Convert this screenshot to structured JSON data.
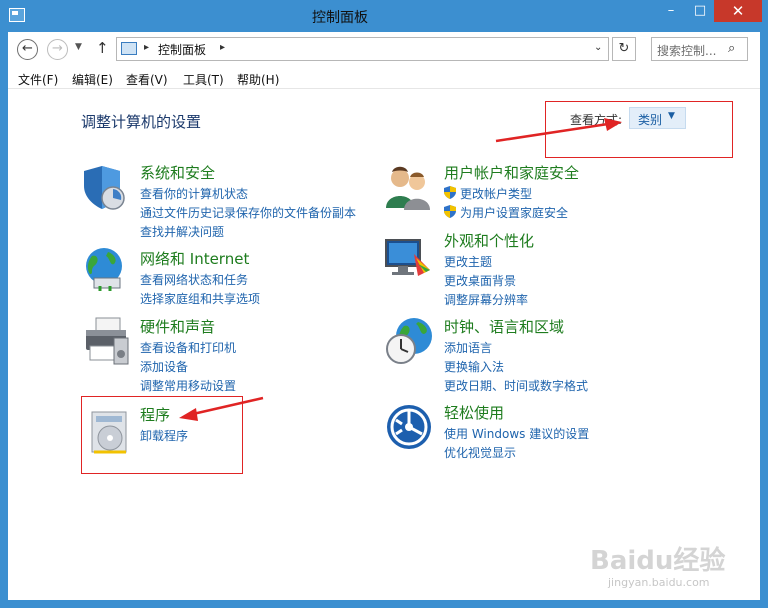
{
  "window": {
    "title": "控制面板",
    "minimize_glyph": "–",
    "maximize_glyph": "□",
    "close_glyph": "✕"
  },
  "nav": {
    "back_glyph": "←",
    "forward_glyph": "→",
    "history_glyph": "▼",
    "up_glyph": "↑",
    "address": "控制面板",
    "address_sep": "▸",
    "dropdown_glyph": "⌄",
    "refresh_glyph": "↻",
    "search_placeholder": "搜索控制...",
    "search_glyph": "⌕"
  },
  "menu": [
    "文件(F)",
    "编辑(E)",
    "查看(V)",
    "工具(T)",
    "帮助(H)"
  ],
  "content": {
    "title": "调整计算机的设置",
    "view_label": "查看方式:",
    "view_value": "类别",
    "view_caret": "▼"
  },
  "categories": [
    {
      "name": "system-security",
      "title": "系统和安全",
      "links": [
        "查看你的计算机状态",
        "通过文件历史记录保存你的文件备份副本",
        "查找并解决问题"
      ]
    },
    {
      "name": "user-accounts",
      "title": "用户帐户和家庭安全",
      "links": [
        "更改帐户类型",
        "为用户设置家庭安全"
      ]
    },
    {
      "name": "network",
      "title": "网络和 Internet",
      "links": [
        "查看网络状态和任务",
        "选择家庭组和共享选项"
      ]
    },
    {
      "name": "appearance",
      "title": "外观和个性化",
      "links": [
        "更改主题",
        "更改桌面背景",
        "调整屏幕分辨率"
      ]
    },
    {
      "name": "hardware",
      "title": "硬件和声音",
      "links": [
        "查看设备和打印机",
        "添加设备",
        "调整常用移动设置"
      ]
    },
    {
      "name": "clock",
      "title": "时钟、语言和区域",
      "links": [
        "添加语言",
        "更换输入法",
        "更改日期、时间或数字格式"
      ]
    },
    {
      "name": "programs",
      "title": "程序",
      "links": [
        "卸载程序"
      ]
    },
    {
      "name": "ease-of-access",
      "title": "轻松使用",
      "links": [
        "使用 Windows 建议的设置",
        "优化视觉显示"
      ]
    }
  ],
  "watermark": {
    "main": "Baidu经验",
    "sub": "jingyan.baidu.com"
  },
  "colors": {
    "titlebar": "#3c8fd0",
    "category_title": "#1e7c1e",
    "link": "#1f64ad",
    "annotation": "#e02424"
  }
}
